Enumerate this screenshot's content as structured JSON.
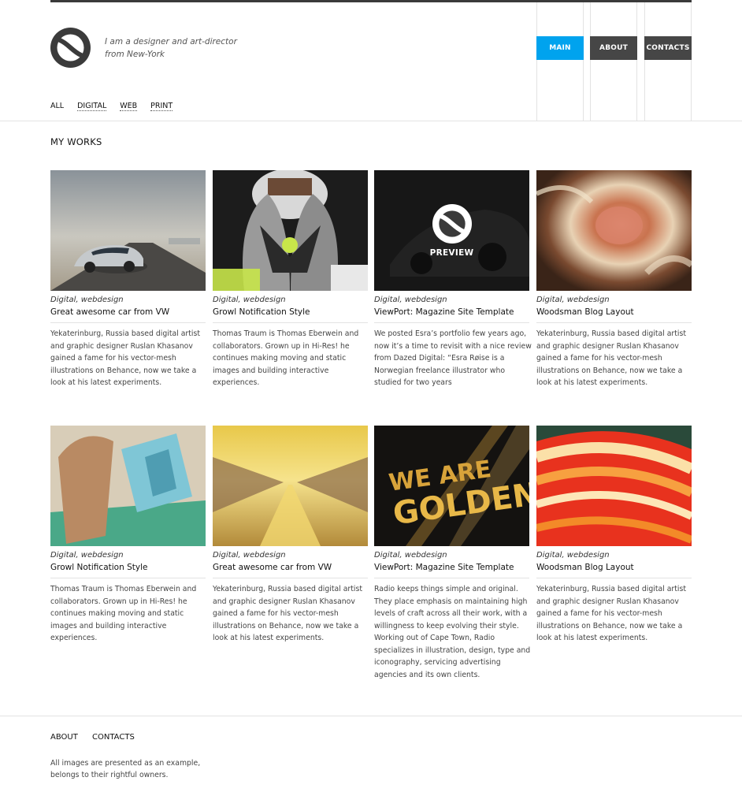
{
  "header": {
    "tagline_line1": "I am a designer and art-director",
    "tagline_line2": "from New-York",
    "nav": [
      {
        "label": "MAIN",
        "active": true
      },
      {
        "label": "ABOUT",
        "active": false
      },
      {
        "label": "CONTACTS",
        "active": false
      }
    ],
    "filters": [
      "ALL",
      "DIGITAL",
      "WEB",
      "PRINT"
    ],
    "accent_color": "#00a3ee",
    "nav_color": "#464646"
  },
  "main": {
    "title": "MY WORKS",
    "preview_label": "PREVIEW",
    "works": [
      {
        "category": "Digital, webdesign",
        "title": "Great awesome car from VW",
        "image": "car-desert-image",
        "description": "Yekaterinburg, Russia based digital artist and graphic designer Ruslan Khasanov gained a fame for his vector-mesh illustrations on Behance, now we take a look at his latest experiments."
      },
      {
        "category": "Digital, webdesign",
        "title": "Growl Notification Style",
        "image": "football-gloves-image",
        "description": "Thomas Traum is Thomas Eberwein and collaborators. Grown up in Hi-Res! he continues making moving and static images and building interactive experiences."
      },
      {
        "category": "Digital, webdesign",
        "title": "ViewPort: Magazine Site Template",
        "image": "dark-car-image",
        "description": "We posted Esra’s portfolio few years ago, now it’s a time to revisit with a nice review from Dazed Digital: “Esra Røise is a Norwegian freelance illustrator who studied for two years"
      },
      {
        "category": "Digital, webdesign",
        "title": "Woodsman Blog Layout",
        "image": "abstract-texture-image",
        "description": "Yekaterinburg, Russia based digital artist and graphic designer Ruslan Khasanov gained a fame for his vector-mesh illustrations on Behance, now we take a look at his latest experiments."
      },
      {
        "category": "Digital, webdesign",
        "title": "Growl Notification Style",
        "image": "3d-letters-image",
        "description": "Thomas Traum is Thomas Eberwein and collaborators. Grown up in Hi-Res! he continues making moving and static images and building interactive experiences."
      },
      {
        "category": "Digital, webdesign",
        "title": "Great awesome car from VW",
        "image": "golden-corridor-image",
        "description": "Yekaterinburg, Russia based digital artist and graphic designer Ruslan Khasanov gained a fame for his vector-mesh illustrations on Behance, now we take a look at his latest experiments."
      },
      {
        "category": "Digital, webdesign",
        "title": "ViewPort: Magazine Site Template",
        "image": "we-are-golden-image",
        "image_text_line1": "WE ARE",
        "image_text_line2": "GOLDEN",
        "description": "Radio keeps things simple and original. They place emphasis on maintaining high levels of craft across all their work, with a willingness to keep evolving their style. Working out of Cape Town, Radio specializes in illustration, design, type and iconography, servicing advertising agencies and its own clients."
      },
      {
        "category": "Digital, webdesign",
        "title": "Woodsman Blog Layout",
        "image": "orange-swirl-image",
        "description": "Yekaterinburg, Russia based digital artist and graphic designer Ruslan Khasanov gained a fame for his vector-mesh illustrations on Behance, now we take a look at his latest experiments."
      }
    ]
  },
  "footer": {
    "nav": [
      "ABOUT",
      "CONTACTS"
    ],
    "note": "All images are presented as an example, belongs to their rightful owners."
  }
}
